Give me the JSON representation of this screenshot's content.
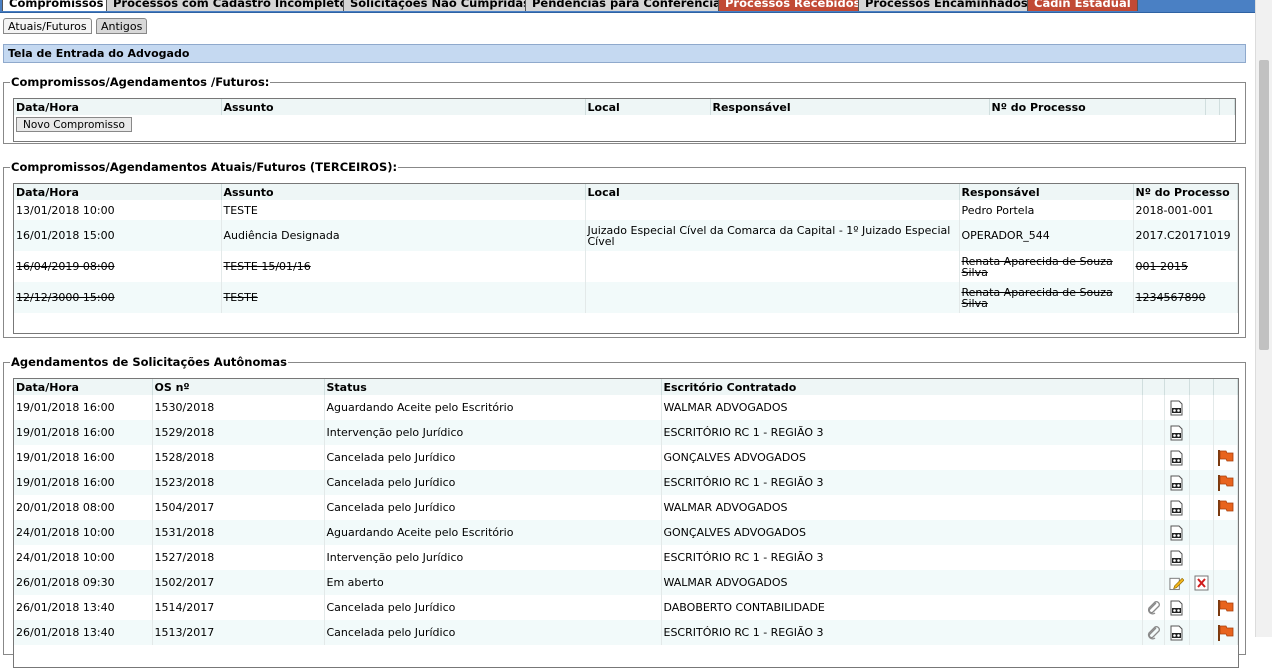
{
  "top_tabs": [
    {
      "label": "Compromissos",
      "style": "active"
    },
    {
      "label": "Processos com Cadastro Incompleto",
      "style": "normal"
    },
    {
      "label": "Solicitações Não Cumpridas",
      "style": "normal"
    },
    {
      "label": "Pendências para Conferência",
      "style": "normal"
    },
    {
      "label": "Processos Recebidos",
      "style": "red"
    },
    {
      "label": "Processos Encaminhados",
      "style": "normal"
    },
    {
      "label": "Cadin Estadual",
      "style": "red"
    }
  ],
  "sub_tabs": [
    {
      "label": "Atuais/Futuros"
    },
    {
      "label": "Antigos"
    }
  ],
  "page_title": "Tela de Entrada do Advogado",
  "section_futuros": {
    "legend": "Compromissos/Agendamentos /Futuros:",
    "headers": [
      "Data/Hora",
      "Assunto",
      "Local",
      "Responsável",
      "Nº do Processo"
    ],
    "new_button": "Novo Compromisso"
  },
  "section_terceiros": {
    "legend": "Compromissos/Agendamentos Atuais/Futuros (TERCEIROS):",
    "headers": [
      "Data/Hora",
      "Assunto",
      "Local",
      "Responsável",
      "Nº do Processo"
    ],
    "rows": [
      {
        "data": "13/01/2018 10:00",
        "assunto": "TESTE",
        "local": "",
        "responsavel": "Pedro Portela",
        "processo": "2018-001-001",
        "strike": false
      },
      {
        "data": "16/01/2018 15:00",
        "assunto": "Audiência Designada",
        "local": "Juizado Especial Cível da Comarca da Capital - 1º Juizado Especial Cível",
        "responsavel": "OPERADOR_544",
        "processo": "2017.C20171019",
        "strike": false
      },
      {
        "data": "16/04/2019 08:00",
        "assunto": "TESTE 15/01/16",
        "local": "",
        "responsavel": "Renata Aparecida de Souza Silva",
        "processo": "001 2015",
        "strike": true
      },
      {
        "data": "12/12/3000 15:00",
        "assunto": "TESTE",
        "local": "",
        "responsavel": "Renata Aparecida de Souza Silva",
        "processo": "1234567890",
        "strike": true
      }
    ]
  },
  "section_autonomas": {
    "legend": "Agendamentos de Solicitações Autônomas",
    "headers": [
      "Data/Hora",
      "OS nº",
      "Status",
      "Escritório Contratado"
    ],
    "rows": [
      {
        "data": "19/01/2018 16:00",
        "os": "1530/2018",
        "status": "Aguardando Aceite pelo Escritório",
        "escritorio": "WALMAR ADVOGADOS",
        "icons": [
          "view-icon"
        ]
      },
      {
        "data": "19/01/2018 16:00",
        "os": "1529/2018",
        "status": "Intervenção pelo Jurídico",
        "escritorio": "ESCRITÓRIO RC 1 - REGIÃO 3",
        "icons": [
          "view-icon"
        ]
      },
      {
        "data": "19/01/2018 16:00",
        "os": "1528/2018",
        "status": "Cancelada pelo Jurídico",
        "escritorio": "GONÇALVES ADVOGADOS",
        "icons": [
          "view-icon",
          "flag-icon"
        ]
      },
      {
        "data": "19/01/2018 16:00",
        "os": "1523/2018",
        "status": "Cancelada pelo Jurídico",
        "escritorio": "ESCRITÓRIO RC 1 - REGIÃO 3",
        "icons": [
          "view-icon",
          "flag-icon"
        ]
      },
      {
        "data": "20/01/2018 08:00",
        "os": "1504/2017",
        "status": "Cancelada pelo Jurídico",
        "escritorio": "WALMAR ADVOGADOS",
        "icons": [
          "view-icon",
          "flag-icon"
        ]
      },
      {
        "data": "24/01/2018 10:00",
        "os": "1531/2018",
        "status": "Aguardando Aceite pelo Escritório",
        "escritorio": "GONÇALVES ADVOGADOS",
        "icons": [
          "view-icon"
        ]
      },
      {
        "data": "24/01/2018 10:00",
        "os": "1527/2018",
        "status": "Intervenção pelo Jurídico",
        "escritorio": "ESCRITÓRIO RC 1 - REGIÃO 3",
        "icons": [
          "view-icon"
        ]
      },
      {
        "data": "26/01/2018 09:30",
        "os": "1502/2017",
        "status": "Em aberto",
        "escritorio": "WALMAR ADVOGADOS",
        "icons": [
          "edit-icon",
          "delete-icon"
        ]
      },
      {
        "data": "26/01/2018 13:40",
        "os": "1514/2017",
        "status": "Cancelada pelo Jurídico",
        "escritorio": "DABOBERTO CONTABILIDADE",
        "icons": [
          "attach-icon",
          "view-icon",
          "flag-icon"
        ]
      },
      {
        "data": "26/01/2018 13:40",
        "os": "1513/2017",
        "status": "Cancelada pelo Jurídico",
        "escritorio": "ESCRITÓRIO RC 1 - REGIÃO 3",
        "icons": [
          "attach-icon",
          "view-icon",
          "flag-icon"
        ]
      }
    ]
  },
  "colors": {
    "tabbar": "#4a80c4",
    "tab_red": "#c14a35",
    "title_bg": "#c5d9f1",
    "row_alt": "#f2fafa"
  }
}
